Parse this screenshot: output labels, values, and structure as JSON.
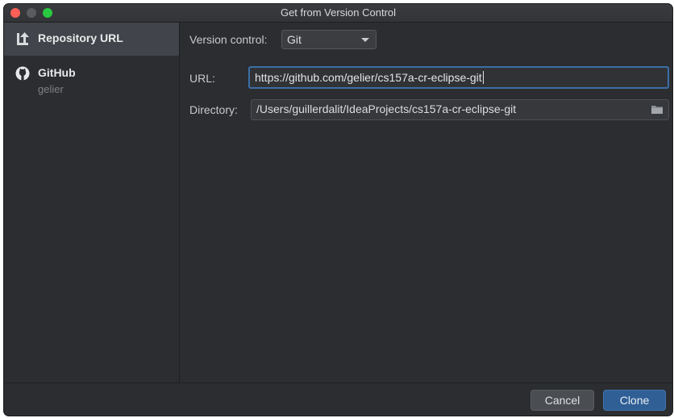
{
  "window": {
    "title": "Get from Version Control"
  },
  "sidebar": {
    "items": [
      {
        "label": "Repository URL",
        "icon": "vcs-branch-icon"
      },
      {
        "label": "GitHub",
        "sublabel": "gelier",
        "icon": "github-icon"
      }
    ]
  },
  "form": {
    "version_control_label": "Version control:",
    "version_control_value": "Git",
    "url_label": "URL:",
    "url_value": "https://github.com/gelier/cs157a-cr-eclipse-git",
    "directory_label": "Directory:",
    "directory_value": "/Users/guillerdalit/IdeaProjects/cs157a-cr-eclipse-git"
  },
  "footer": {
    "cancel_label": "Cancel",
    "clone_label": "Clone"
  },
  "colors": {
    "accent": "#2f5f95",
    "focus_ring": "#3c6fa6",
    "background": "#2b2d30"
  }
}
